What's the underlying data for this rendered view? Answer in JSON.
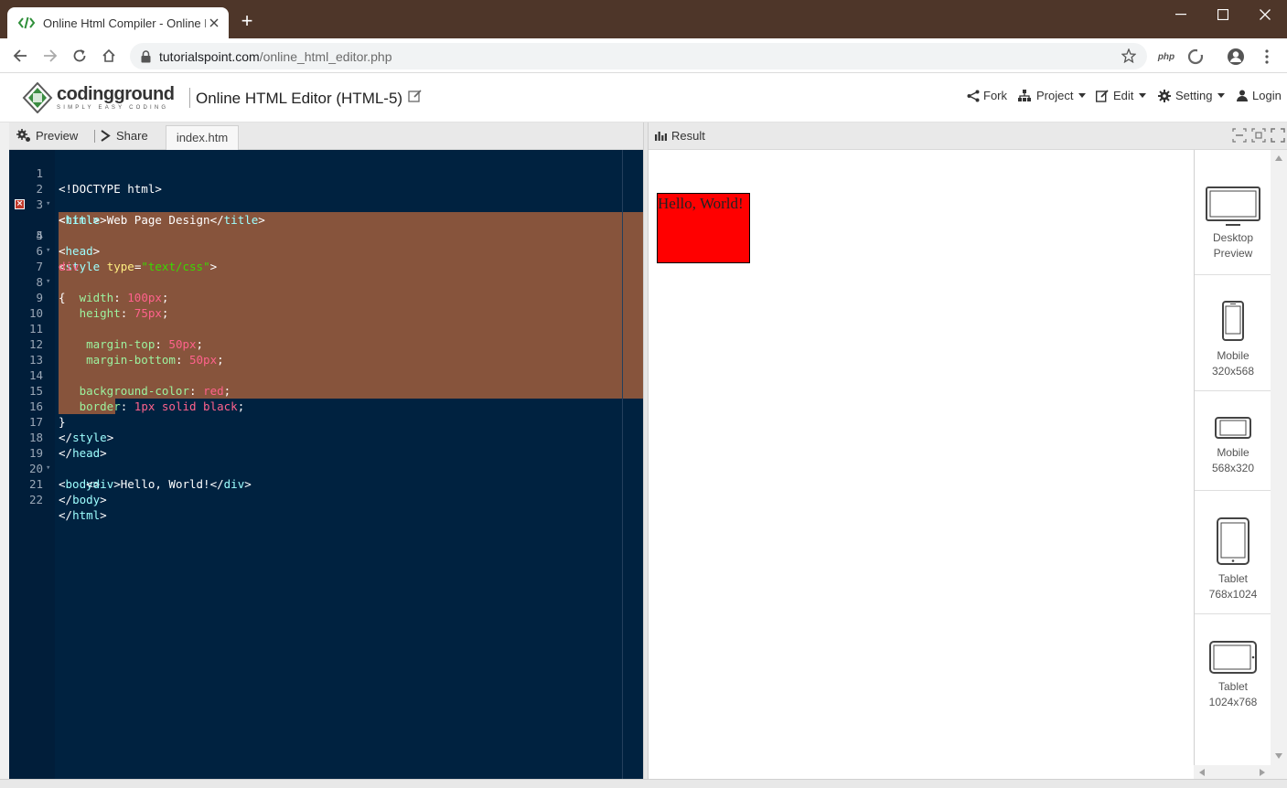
{
  "browser": {
    "tab_title": "Online Html Compiler - Online H",
    "new_tab": "+",
    "url_host": "tutorialspoint.com",
    "url_path": "/online_html_editor.php",
    "ext_php": "php"
  },
  "header": {
    "logo_name": "codingground",
    "logo_tagline": "SIMPLY EASY CODING",
    "page_title": "Online HTML Editor (HTML-5)",
    "menu": {
      "fork": "Fork",
      "project": "Project",
      "edit": "Edit",
      "setting": "Setting",
      "login": "Login"
    }
  },
  "editor": {
    "preview_label": "Preview",
    "share_label": "Share",
    "file_tab": "index.htm",
    "line_numbers": [
      "1",
      "2",
      "3",
      "4",
      "5",
      "6",
      "7",
      "8",
      "9",
      "10",
      "11",
      "12",
      "13",
      "14",
      "15",
      "16",
      "17",
      "18",
      "19",
      "20",
      "21",
      "22"
    ],
    "code": {
      "l1": "<!DOCTYPE html>",
      "l2_open": "<",
      "l2_name": "html",
      "l2_close": ">",
      "l3_a": "<",
      "l3_b": "title",
      "l3_c": ">",
      "l3_text": "Web Page Design",
      "l3_d": "</",
      "l3_e": "title",
      "l3_f": ">",
      "l4_a": "<",
      "l4_b": "head",
      "l4_c": ">",
      "l5_a": "<",
      "l5_b": "style",
      "l5_attr": " type",
      "l5_eq": "=",
      "l5_str": "\"text/css\"",
      "l5_c": ">",
      "l6": "div",
      "l7": "{",
      "l8_prop": "   width",
      "l8_colon": ": ",
      "l8_val": "100px",
      "l8_semi": ";",
      "l9_prop": "   height",
      "l9_colon": ": ",
      "l9_val": "75px",
      "l9_semi": ";",
      "l11_prop": "    margin-top",
      "l11_colon": ": ",
      "l11_val": "50px",
      "l11_semi": ";",
      "l12_prop": "    margin-bottom",
      "l12_colon": ": ",
      "l12_val": "50px",
      "l12_semi": ";",
      "l14_prop": "   background-color",
      "l14_colon": ": ",
      "l14_val": "red",
      "l14_semi": ";",
      "l15_prop": "   border",
      "l15_colon": ": ",
      "l15_val": "1px solid black",
      "l15_semi": ";",
      "l16": "}",
      "l17_a": "</",
      "l17_b": "style",
      "l17_c": ">",
      "l18_a": "</",
      "l18_b": "head",
      "l18_c": ">",
      "l19_a": "<",
      "l19_b": "body",
      "l19_c": ">",
      "l20_pad": "    ",
      "l20_a": "<",
      "l20_b": "div",
      "l20_c": ">",
      "l20_text": "Hello, World!",
      "l20_d": "</",
      "l20_e": "div",
      "l20_f": ">",
      "l21_a": "</",
      "l21_b": "body",
      "l21_c": ">",
      "l22_a": "</",
      "l22_b": "html",
      "l22_c": ">"
    }
  },
  "result": {
    "title": "Result",
    "hello_text": "Hello, World!",
    "devices": [
      {
        "line1": "Desktop",
        "line2": "Preview"
      },
      {
        "line1": "Mobile",
        "line2": "320x568"
      },
      {
        "line1": "Mobile",
        "line2": "568x320"
      },
      {
        "line1": "Tablet",
        "line2": "768x1024"
      },
      {
        "line1": "Tablet",
        "line2": "1024x768"
      }
    ]
  },
  "colors": {
    "titlebar": "#4e3629",
    "editor_bg": "#002240",
    "selection": "#87543c",
    "hello_bg": "#ff0000"
  }
}
